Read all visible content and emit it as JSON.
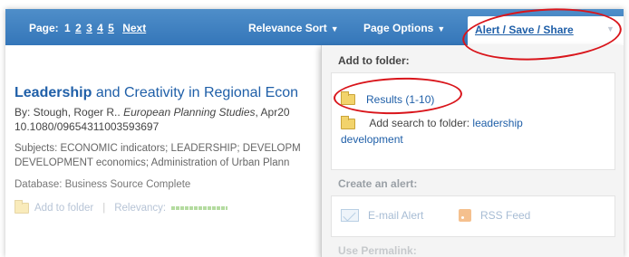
{
  "toolbar": {
    "page_label": "Page:",
    "pages": [
      "1",
      "2",
      "3",
      "4",
      "5"
    ],
    "next_label": "Next",
    "relevance_sort": "Relevance Sort",
    "page_options": "Page Options",
    "alert_save_share": "Alert / Save / Share"
  },
  "result": {
    "title_bold": "Leadership",
    "title_rest": "and Creativity in Regional Econ",
    "byline_prefix": "By: Stough, Roger R..",
    "journal": "European Planning Studies",
    "byline_suffix": ", Apr20",
    "doi": "10.1080/09654311003593697",
    "subjects_line1": "Subjects: ECONOMIC indicators; LEADERSHIP; DEVELOPM",
    "subjects_line2": "DEVELOPMENT economics; Administration of Urban Plann",
    "database": "Database: Business Source Complete",
    "add_to_folder": "Add to folder",
    "relevancy_label": "Relevancy:"
  },
  "menu": {
    "add_to_folder_header": "Add to folder:",
    "results_link": "Results (1-10)",
    "add_search_prefix": "Add search to folder:",
    "add_search_link_line1": "leadership",
    "add_search_link_line2": "development",
    "create_alert_header": "Create an alert:",
    "email_alert": "E-mail Alert",
    "rss_feed": "RSS Feed",
    "use_permalink_header": "Use Permalink:"
  },
  "colors": {
    "toolbar_blue": "#3f82c3",
    "link_blue": "#1f5fa8",
    "highlight_red": "#d9151b"
  },
  "icons": [
    "folder-icon",
    "chevron-down-icon",
    "email-icon",
    "rss-icon"
  ]
}
